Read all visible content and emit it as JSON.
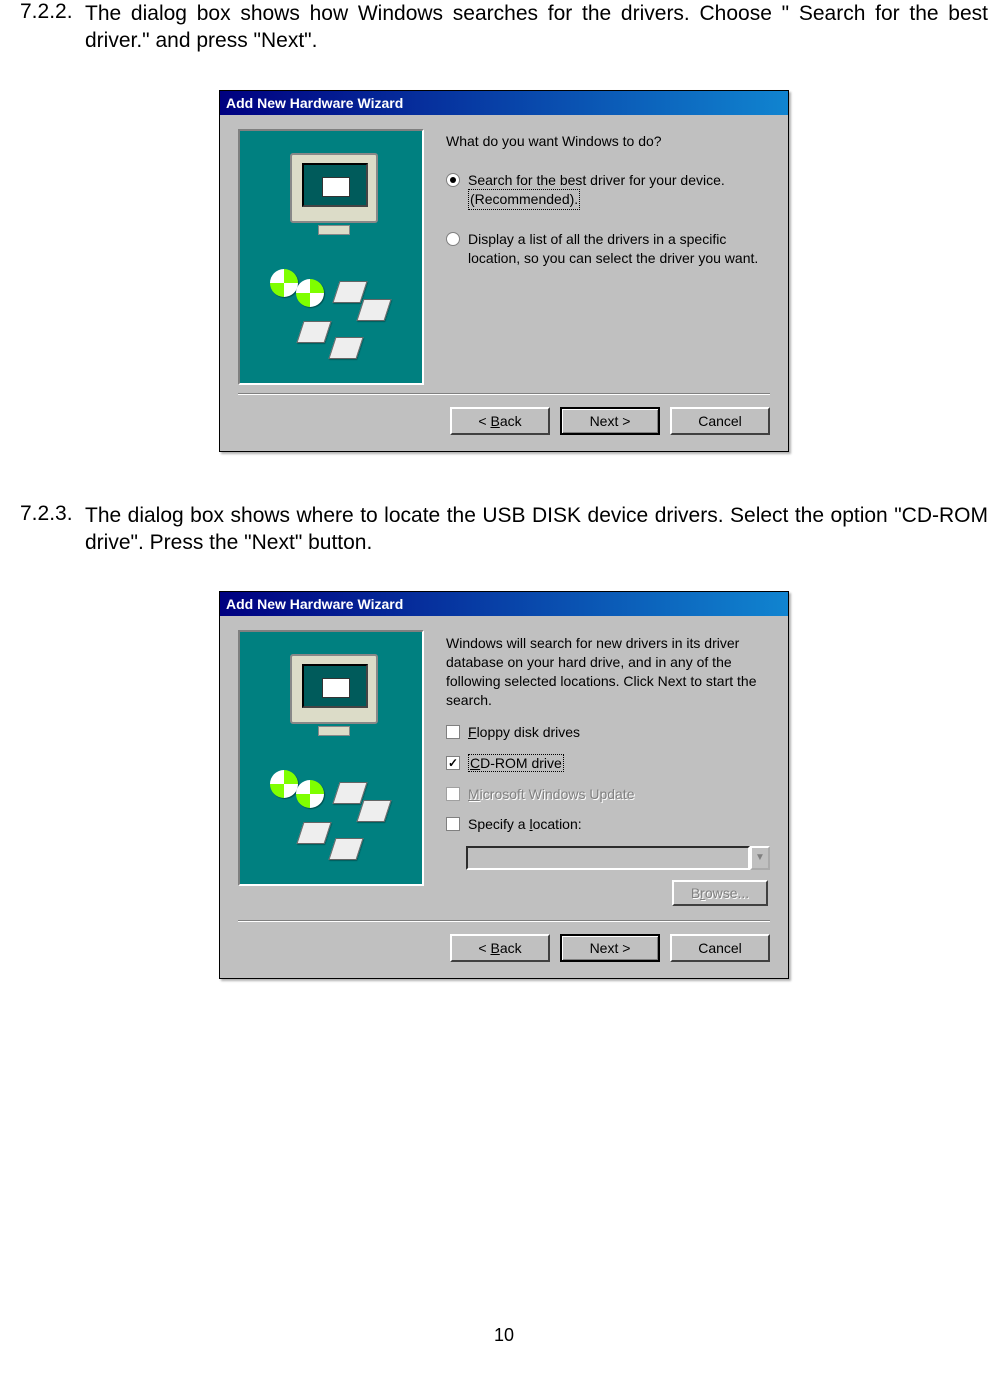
{
  "sections": {
    "s1": {
      "num": "7.2.2.",
      "text": "The dialog box shows how Windows searches for the drivers. Choose \" Search for the best driver.\" and press  \"Next\"."
    },
    "s2": {
      "num": "7.2.3.",
      "text": "The dialog box shows where to locate the USB DISK device drivers. Select the option \"CD-ROM drive\". Press the \"Next\" button."
    }
  },
  "dialog1": {
    "title": "Add New Hardware Wizard",
    "prompt": "What do you want Windows to do?",
    "opt1_line1": "Search for the best driver for your device.",
    "opt1_line2": "(Recommended).",
    "opt2_line1": "Display a list of all the drivers in a specific",
    "opt2_line2": "location, so you can select the driver you want.",
    "back": "< Back",
    "next": "Next >",
    "cancel": "Cancel"
  },
  "dialog2": {
    "title": "Add New Hardware Wizard",
    "intro": "Windows will search for new drivers in its driver database on your hard drive, and in any of the following selected locations. Click Next to start the search.",
    "chk_floppy": "Floppy disk drives",
    "chk_cdrom": "CD-ROM drive",
    "chk_msupdate": "Microsoft Windows Update",
    "chk_specify": "Specify a location:",
    "browse": "Browse...",
    "back": "< Back",
    "next": "Next >",
    "cancel": "Cancel"
  },
  "page_number": "10"
}
